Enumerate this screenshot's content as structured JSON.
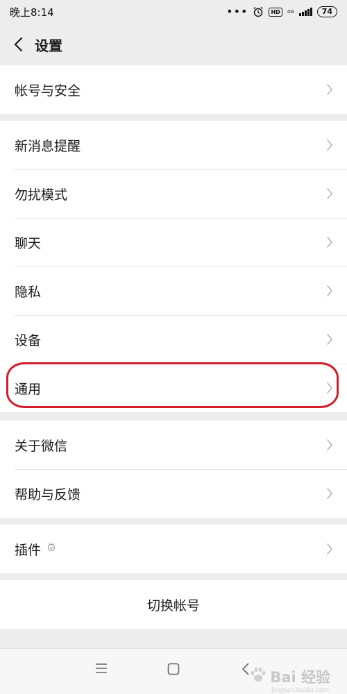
{
  "status_bar": {
    "time": "晚上8:14",
    "dots": "•••",
    "hd": "HD",
    "network": "4G",
    "battery": "74",
    "icons": [
      "alarm-clock-icon",
      "signal-icon"
    ]
  },
  "nav": {
    "title": "设置",
    "back_icon": "chevron-left-icon"
  },
  "groups": [
    {
      "items": [
        "帐号与安全"
      ]
    },
    {
      "items": [
        "新消息提醒",
        "勿扰模式",
        "聊天",
        "隐私",
        "设备",
        "通用"
      ]
    },
    {
      "items": [
        "关于微信",
        "帮助与反馈"
      ]
    },
    {
      "items": [
        "插件"
      ]
    }
  ],
  "switch_account": "切换帐号",
  "highlighted_item": "通用",
  "highlight_color": "#d21d28",
  "watermark": {
    "text": "Bai 经验",
    "sub": "jingyan.baidu.com"
  }
}
